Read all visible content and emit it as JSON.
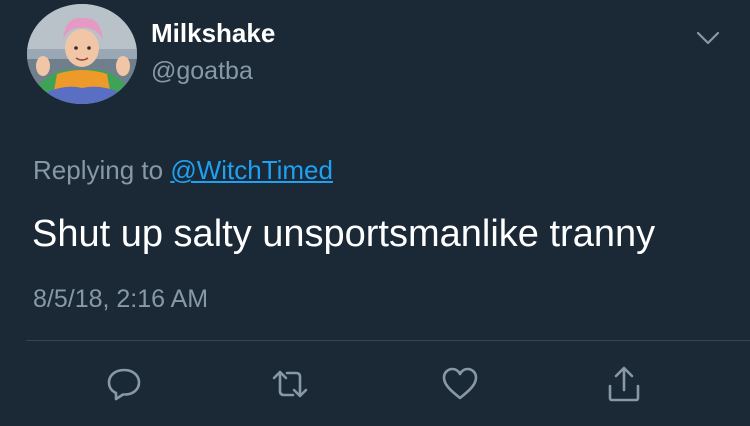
{
  "user": {
    "display_name": "Milkshake",
    "handle": "@goatba"
  },
  "reply": {
    "prefix": "Replying to ",
    "mention": "@WitchTimed"
  },
  "tweet": {
    "text": "Shut up salty unsportsmanlike tranny",
    "timestamp": "8/5/18, 2:16 AM"
  },
  "actions": [
    {
      "icon": "reply-icon"
    },
    {
      "icon": "retweet-icon"
    },
    {
      "icon": "like-icon"
    },
    {
      "icon": "share-icon"
    }
  ],
  "colors": {
    "background": "#1b2836",
    "primary_text": "#ffffff",
    "secondary_text": "#8899a6",
    "link": "#1da1f2",
    "divider": "#38444d"
  }
}
